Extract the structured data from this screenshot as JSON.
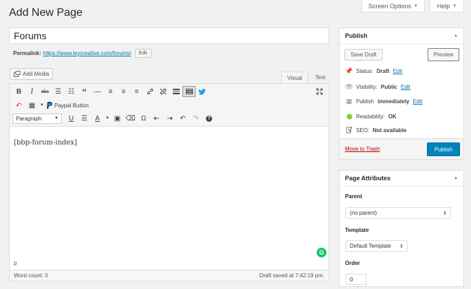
{
  "header": {
    "screen_options": "Screen Options",
    "help": "Help",
    "page_title": "Add New Page"
  },
  "post": {
    "title": "Forums",
    "permalink_label": "Permalink:",
    "permalink_url": "https://www.leycreative.com/forums/",
    "edit_label": "Edit"
  },
  "editor": {
    "add_media": "Add Media",
    "tabs": [
      "Visual",
      "Text"
    ],
    "paypal_label": "Paypal Button",
    "format_select": "Paragraph",
    "content": "[bbp-forum-index]",
    "path": "p",
    "word_count": "Word count: 0",
    "draft_saved": "Draft saved at 7:42:19 pm."
  },
  "publish_box": {
    "title": "Publish",
    "save_draft": "Save Draft",
    "preview": "Preview",
    "status_label": "Status:",
    "status_value": "Draft",
    "visibility_label": "Visibility:",
    "visibility_value": "Public",
    "publish_label": "Publish",
    "publish_value": "immediately",
    "readability_label": "Readability:",
    "readability_value": "OK",
    "seo_label": "SEO:",
    "seo_value": "Not available",
    "edit_link": "Edit",
    "move_to_trash": "Move to Trash",
    "publish_button": "Publish"
  },
  "page_attributes": {
    "title": "Page Attributes",
    "parent_label": "Parent",
    "parent_value": "(no parent)",
    "template_label": "Template",
    "template_value": "Default Template",
    "order_label": "Order",
    "order_value": "0"
  },
  "colors": {
    "link": "#0073aa",
    "primary_button": "#0085ba",
    "trash": "#a00",
    "grammarly": "#15c26b"
  }
}
